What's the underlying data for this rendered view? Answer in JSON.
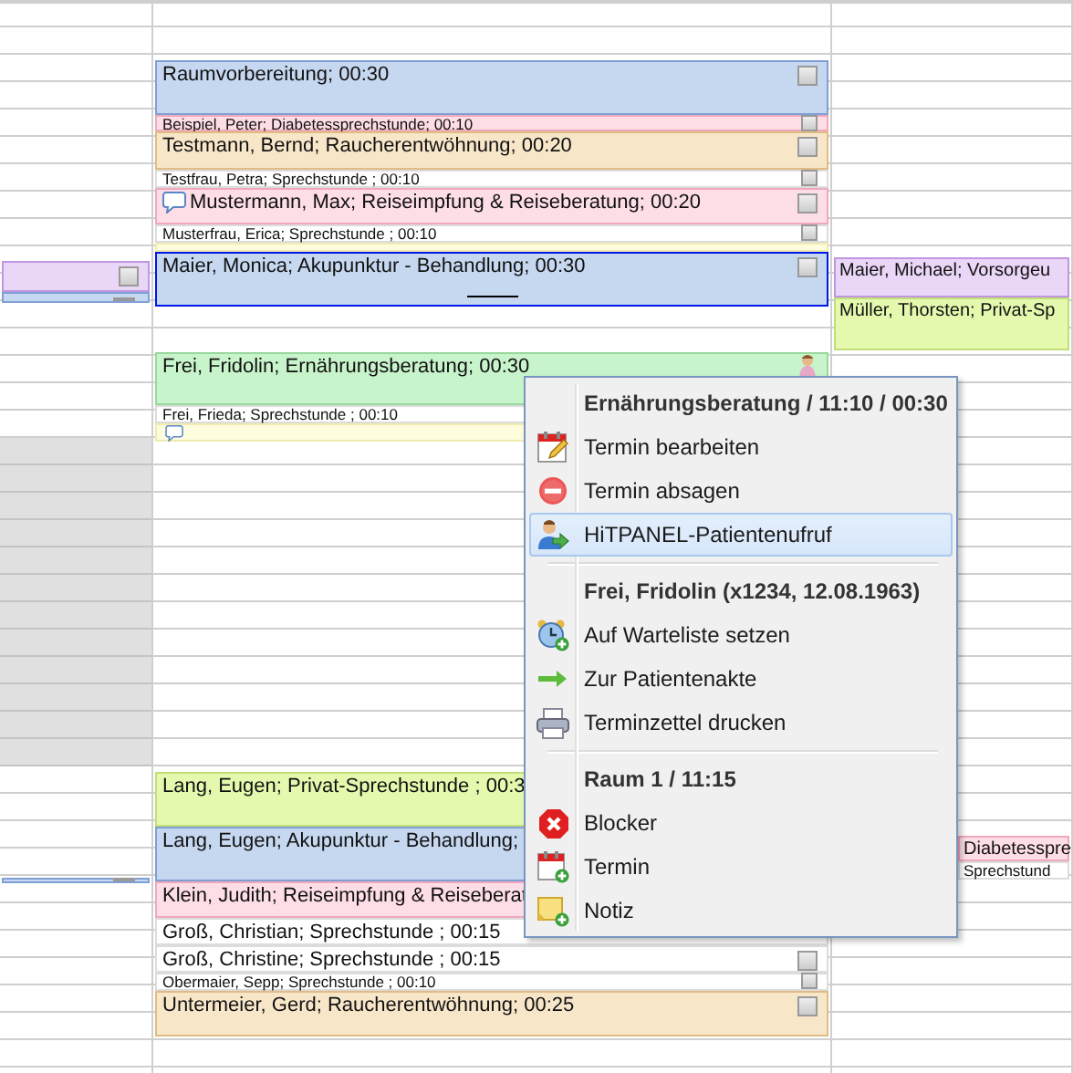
{
  "calendar": {
    "columns": [
      {
        "entries": [
          {
            "color": "#ead6f7",
            "checked": false
          },
          {
            "color": "#c6d7f0"
          },
          {
            "color": "#c6d7f0"
          }
        ]
      },
      {
        "entries": [
          {
            "text": "Raumvorbereitung; 00:30",
            "color": "#c6d7f0",
            "selected": false,
            "checked": false
          },
          {
            "text": "Beispiel, Peter; Diabetessprechstunde; 00:10",
            "color": "#fddde6",
            "selected": false,
            "checked": false
          },
          {
            "text": "Testmann, Bernd; Raucherentwöhnung; 00:20",
            "color": "#f8e6c9",
            "selected": false,
            "checked": false
          },
          {
            "text": "Testfrau, Petra; Sprechstunde ; 00:10",
            "color": "#ffffff",
            "selected": false,
            "checked": false
          },
          {
            "text": "Mustermann, Max; Reiseimpfung & Reiseberatung; 00:20",
            "color": "#fddde6",
            "selected": false,
            "checked": false,
            "comment": true
          },
          {
            "text": "Musterfrau, Erica; Sprechstunde ; 00:10",
            "color": "#ffffff",
            "selected": false,
            "checked": false
          },
          {
            "color": "#fdfcdc",
            "selected": false
          },
          {
            "text": "Maier, Monica; Akupunktur - Behandlung; 00:30",
            "color": "#c6d7f0",
            "selected": true,
            "checked": false
          },
          {
            "text": "Frei, Fridolin; Ernährungsberatung; 00:30",
            "color": "#c8f4cc",
            "selected": false,
            "patient_called": true
          },
          {
            "text": "Frei, Frieda; Sprechstunde ; 00:10",
            "color": "#ffffff",
            "selected": false
          },
          {
            "color": "#fdfcdc",
            "selected": false,
            "comment": true
          },
          {
            "text": "Lang, Eugen; Privat-Sprechstunde ; 00:3",
            "color": "#e5f9ae",
            "selected": false
          },
          {
            "text": "Lang, Eugen; Akupunktur - Behandlung;",
            "color": "#c6d7f0",
            "selected": false
          },
          {
            "text": "Klein, Judith; Reiseimpfung & Reiseberat",
            "color": "#fddde6",
            "selected": false
          },
          {
            "text": "Groß, Christian; Sprechstunde ; 00:15",
            "color": "#ffffff",
            "selected": false
          },
          {
            "text": "Groß, Christine; Sprechstunde ; 00:15",
            "color": "#ffffff",
            "selected": false,
            "checked": false
          },
          {
            "text": "Obermaier, Sepp; Sprechstunde ; 00:10",
            "color": "#ffffff",
            "selected": false,
            "checked": false
          },
          {
            "text": "Untermeier, Gerd; Raucherentwöhnung; 00:25",
            "color": "#f8e6c9",
            "selected": false,
            "checked": false
          }
        ]
      },
      {
        "entries": [
          {
            "text": "Maier, Michael; Vorsorgeu",
            "color": "#ead6f7"
          },
          {
            "text": "Müller, Thorsten; Privat-Sp",
            "color": "#e5f9ae"
          },
          {
            "text": "Diabetesspre",
            "color": "#fddde6"
          },
          {
            "text": "Sprechstund",
            "color": "#ffffff"
          }
        ]
      }
    ]
  },
  "context_menu": {
    "sections": [
      {
        "header": "Ernährungsberatung / 11:10 / 00:30",
        "items": [
          {
            "label": "Termin bearbeiten",
            "selected": false
          },
          {
            "label": "Termin absagen",
            "selected": false
          },
          {
            "label": "HiTPANEL-Patientenufruf",
            "selected": true
          }
        ]
      },
      {
        "header": "Frei, Fridolin (x1234, 12.08.1963)",
        "items": [
          {
            "label": "Auf Warteliste setzen",
            "selected": false
          },
          {
            "label": "Zur Patientenakte",
            "selected": false
          },
          {
            "label": "Terminzettel drucken",
            "selected": false
          }
        ]
      },
      {
        "header": "Raum 1 / 11:15",
        "items": [
          {
            "label": "Blocker",
            "selected": false
          },
          {
            "label": "Termin",
            "selected": false
          },
          {
            "label": "Notiz",
            "selected": false
          }
        ]
      }
    ]
  }
}
